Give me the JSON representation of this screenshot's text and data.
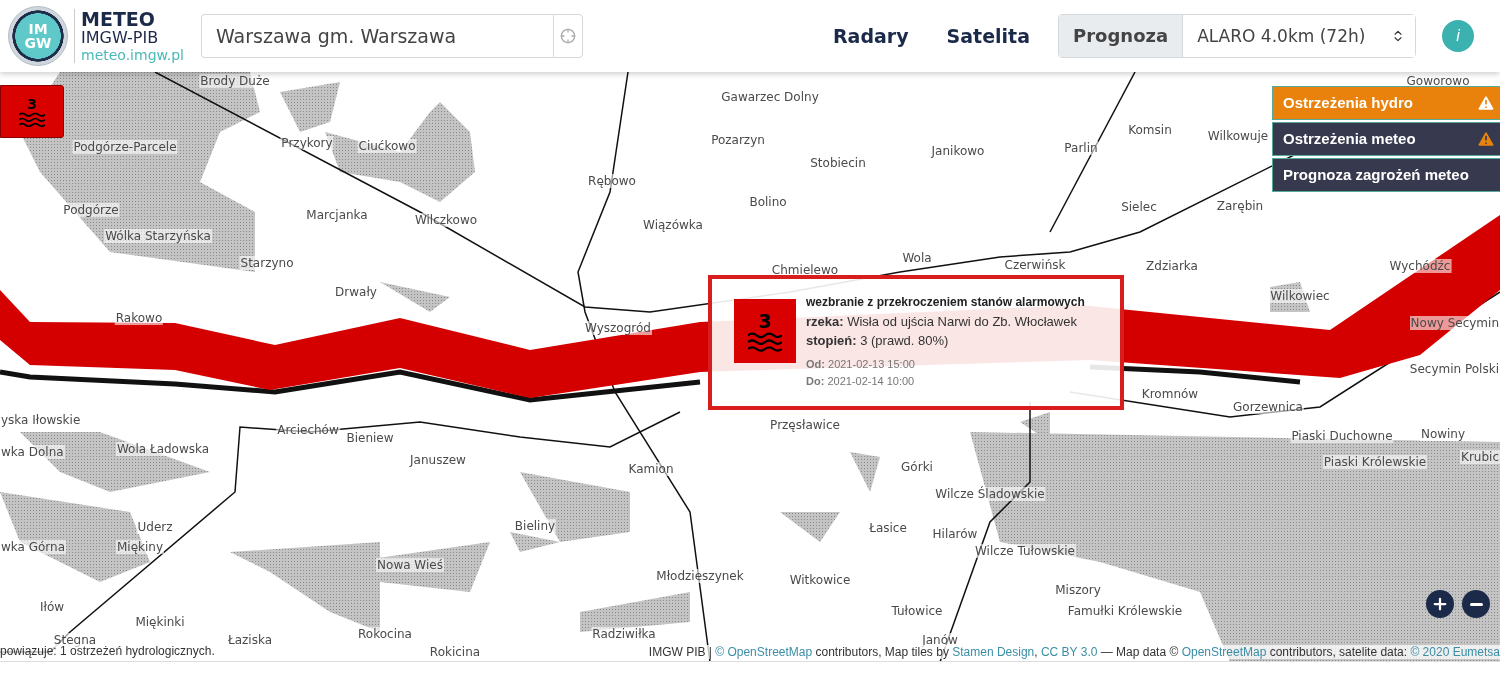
{
  "header": {
    "logo_text": [
      "IM",
      "GW"
    ],
    "brand": "METEO",
    "org": "IMGW-PIB",
    "site": "meteo.imgw.pl",
    "search": {
      "value": "Warszawa gm. Warszawa"
    },
    "nav": [
      {
        "label": "Radary"
      },
      {
        "label": "Satelita"
      }
    ],
    "forecast": {
      "label": "Prognoza",
      "model": "ALARO 4.0km (72h)"
    },
    "info": "i"
  },
  "alert_badge": {
    "level": "3"
  },
  "warning_panel": [
    {
      "label": "Ostrzeżenia hydro",
      "selected": true,
      "alert": true
    },
    {
      "label": "Ostrzeżenia meteo",
      "selected": false,
      "alert": true
    },
    {
      "label": "Prognoza zagrożeń meteo",
      "selected": false,
      "alert": false
    }
  ],
  "popup": {
    "level": "3",
    "title": "wezbranie z przekroczeniem stanów alarmowych",
    "fields": [
      {
        "key": "rzeka:",
        "value": "Wisła od ujścia Narwi do Zb. Włocławek"
      },
      {
        "key": "stopień:",
        "value": "3 (prawd. 80%)"
      }
    ],
    "dates": [
      {
        "key": "Od:",
        "value": "2021-02-13 15:00"
      },
      {
        "key": "Do:",
        "value": "2021-02-14 10:00"
      }
    ]
  },
  "map": {
    "places": [
      "Brody Duże",
      "Goworowo",
      "Gawarzec Dolny",
      "Podgórze-Parcele",
      "Przykory",
      "Ciućkowo",
      "Pozarzyn",
      "Komsin",
      "Wilkowuje",
      "Janikowo",
      "Parlin",
      "Stobiecin",
      "Rębowo",
      "Podgórze",
      "Marcjanka",
      "Wilczkowo",
      "Wiązówka",
      "Bolino",
      "Sielec",
      "Zarębin",
      "Wólka Starzyńska",
      "Starzyno",
      "Wola",
      "Chmielewo",
      "Czerwińsk",
      "Zdziarka",
      "Wychódźc",
      "Drwały",
      "Wilkowiec",
      "Rakowo",
      "Wyszogród",
      "Nowy Secymin",
      "Secymin Polski",
      "Kromnów",
      "Gorzewnica",
      "Przęsławice",
      "Piaski Duchowne",
      "Nowiny",
      "Krubic",
      "Piaski Królewskie",
      "Górki",
      "Wilcze Śladowskie",
      "Łasice",
      "Hilarów",
      "Wilcze Tułowskie",
      "Witkowice",
      "Miszory",
      "Tułowice",
      "Famułki Królewskie",
      "Janów",
      "yska Iłowskie",
      "wka Dolna",
      "Wola Ładowska",
      "Arciechów",
      "Bieniew",
      "Januszew",
      "Kamion",
      "Bieliny",
      "wka Górna",
      "Uderz",
      "Miękiny",
      "Nowa Wieś",
      "Młodzieszynek",
      "Iłów",
      "Miękinki",
      "Stegna",
      "Łaziska",
      "Rokocina",
      "Radziwiłka",
      "Rokicina"
    ]
  },
  "status": "powiązuje: 1 ostrzeżeń hydrologicznych.",
  "attribution": [
    {
      "kind": "text",
      "text": "IMGW PIB | "
    },
    {
      "kind": "link",
      "text": "© OpenStreetMap"
    },
    {
      "kind": "text",
      "text": " contributors, Map tiles by "
    },
    {
      "kind": "link",
      "text": "Stamen Design"
    },
    {
      "kind": "text",
      "text": ", "
    },
    {
      "kind": "link",
      "text": "CC BY 3.0"
    },
    {
      "kind": "text",
      "text": " — Map data © "
    },
    {
      "kind": "link",
      "text": "OpenStreetMap"
    },
    {
      "kind": "text",
      "text": " contributors, satelite data: "
    },
    {
      "kind": "link",
      "text": "© 2020 Eumetsa"
    }
  ]
}
